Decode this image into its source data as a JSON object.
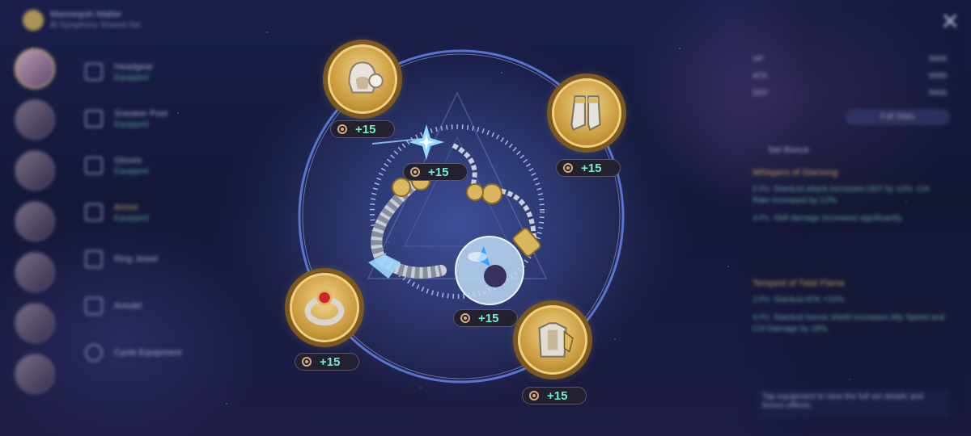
{
  "header": {
    "title": "Mannequin Matter",
    "subtitle": "Bl Symphony   Shared Set"
  },
  "characters": [
    "char-1",
    "char-2",
    "char-3",
    "char-4",
    "char-5",
    "char-6",
    "char-7"
  ],
  "slots": [
    {
      "name": "Headgear",
      "status": "Equipped"
    },
    {
      "name": "Sneaker Pool",
      "status": "Equipped"
    },
    {
      "name": "Gloves",
      "status": "Equipped"
    },
    {
      "name": "Armor",
      "status": "Equipped"
    },
    {
      "name": "Ring Jewel",
      "status": ""
    },
    {
      "name": "Amulet",
      "status": ""
    },
    {
      "name": "Cycle Equipment",
      "status": ""
    }
  ],
  "right_panel": {
    "close": "✕",
    "stats": [
      {
        "label": "HP",
        "value": "9999"
      },
      {
        "label": "ATK",
        "value": "9999"
      },
      {
        "label": "DEF",
        "value": "9999"
      }
    ],
    "detail_button": "Full Stats",
    "set_title": "Set Bonus",
    "sets": [
      {
        "name": "Whispers of Starsong",
        "lines": [
          "2-Pc: Stardust attack increases DEF by 10%. Crit Rate increased by 12%.",
          "4-Pc: Skill damage increased significantly."
        ]
      },
      {
        "name": "Tempest of Tidal Flame",
        "lines": [
          "2-Pc: Stardust ATK +10%.",
          "4-Pc: Stardust bonus shield increases Ally Speed and Crit Damage by 18%."
        ]
      }
    ],
    "footer": "Tap equipment to view the full set details and bonus effects."
  },
  "equipment": [
    {
      "slot": "helmet",
      "icon": "helmet-icon",
      "level": "+15"
    },
    {
      "slot": "boots",
      "icon": "boots-icon",
      "level": "+15"
    },
    {
      "slot": "bracelet",
      "icon": "bracelet-icon",
      "level": "+15"
    },
    {
      "slot": "orb",
      "icon": "crystal-orb-icon",
      "level": "+15"
    },
    {
      "slot": "ring",
      "icon": "ring-icon",
      "level": "+15"
    },
    {
      "slot": "armor",
      "icon": "armor-icon",
      "level": "+15"
    }
  ],
  "colors": {
    "gold": "#e4c77f",
    "level_text": "#6ff0c7",
    "orbit": "#5a7dff"
  }
}
